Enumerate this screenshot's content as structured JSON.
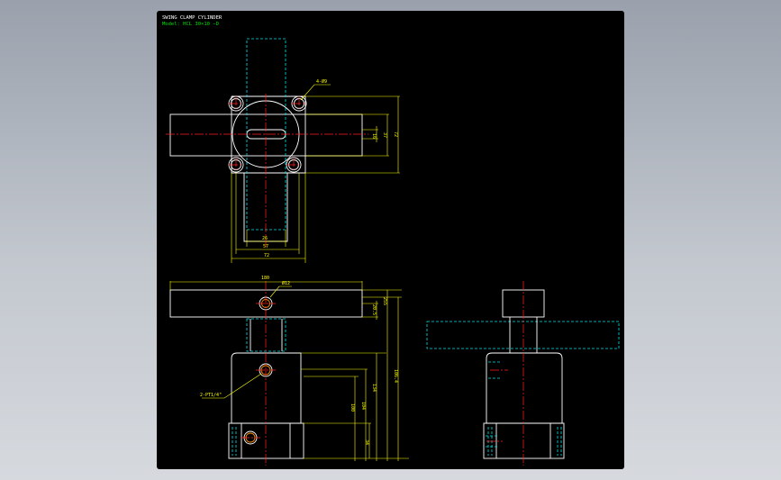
{
  "title_block": {
    "title": "SWING CLAMP CYLINDER",
    "model": "Model: HCL 30×10 −D"
  },
  "dimensions": {
    "top_view": {
      "hole_callout": "4-Ø9",
      "slot_width": "16",
      "inner_height": "37",
      "outer_height": "72",
      "arm_width": "26",
      "bolt_pitch": "57",
      "body_width": "72"
    },
    "front_view": {
      "arm_length": "180",
      "pin_hole": "Ø12",
      "arm_thickness": "20.5",
      "total_height": "255",
      "port_callout": "2-PT1/4\"",
      "dim_100": "100",
      "dim_104": "104",
      "dim_134": "134",
      "dim_34": "34",
      "dim_1064": "106.4"
    }
  },
  "colors": {
    "background": "#000000",
    "outline": "#ffffff",
    "dimension": "#ffff00",
    "center_line": "#ff2020",
    "hidden_line": "#00e5e5",
    "port": "#ff8c00"
  }
}
